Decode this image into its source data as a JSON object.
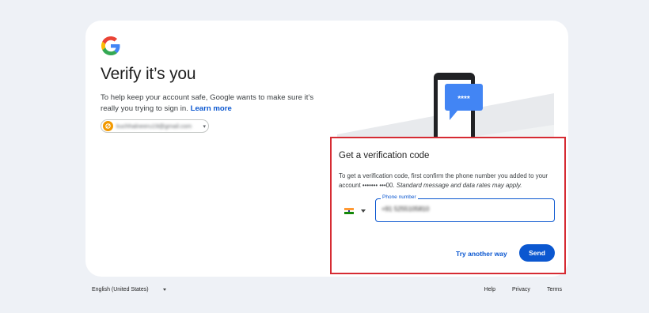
{
  "header": {
    "logo_icon": "google-g-logo-icon",
    "title": "Verify it’s you",
    "subtitle": "To help keep your account safe, Google wants to make sure it’s really you trying to sign in.",
    "learn_more": "Learn more"
  },
  "account": {
    "email": "kuchhalneeru19@gmail.com",
    "avatar_icon": "avatar-icon",
    "chevron_icon": "chevron-down-icon"
  },
  "illustration": {
    "bubble_text": "****"
  },
  "verification": {
    "title": "Get a verification code",
    "description": "To get a verification code, first confirm the phone number you added to your account ••••••• •••00.",
    "note": "Standard message and data rates may apply.",
    "country_flag": "india-flag-icon",
    "phone_label": "Phone number",
    "phone_value": "+91 5255105810",
    "try_another": "Try another way",
    "send": "Send"
  },
  "footer": {
    "language": "English (United States)",
    "links": [
      "Help",
      "Privacy",
      "Terms"
    ]
  },
  "colors": {
    "accent": "#0b57d0",
    "highlight_border": "#d62b33",
    "background": "#eef1f6"
  }
}
